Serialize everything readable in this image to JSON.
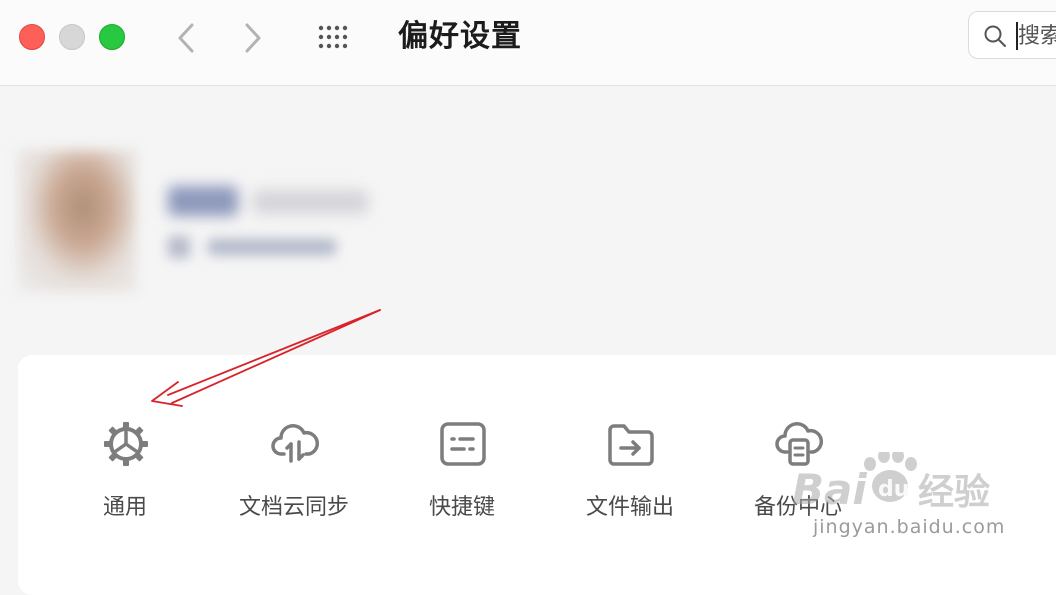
{
  "window": {
    "title": "偏好设置"
  },
  "search": {
    "placeholder": "搜索"
  },
  "settings_items": [
    {
      "label": "通用",
      "icon": "gear-icon"
    },
    {
      "label": "文档云同步",
      "icon": "cloud-sync-icon"
    },
    {
      "label": "快捷键",
      "icon": "keyboard-icon"
    },
    {
      "label": "文件输出",
      "icon": "folder-export-icon"
    },
    {
      "label": "备份中心",
      "icon": "backup-cloud-icon"
    }
  ],
  "watermark": {
    "brand": "经验",
    "url": "jingyan.baidu.com"
  },
  "colors": {
    "close": "#fe5f57",
    "maximize": "#28c840",
    "annotation_arrow": "#d9232a"
  }
}
